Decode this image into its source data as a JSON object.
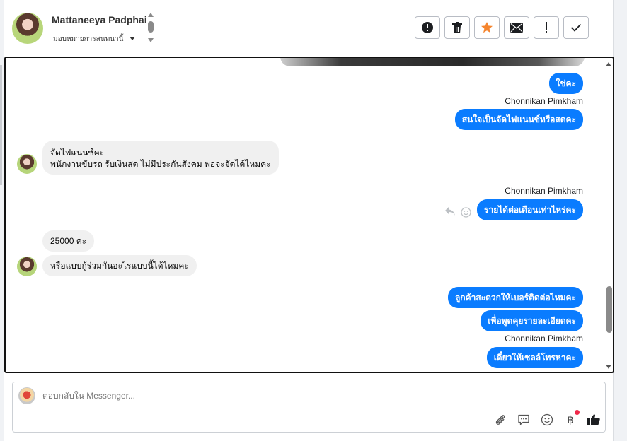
{
  "header": {
    "contact_name": "Mattaneeya Padphai",
    "assign_label": "มอบหมายการสนทนานี้",
    "actions": [
      {
        "icon": "alert-circle-icon",
        "name": "mark-spam-button"
      },
      {
        "icon": "trash-icon",
        "name": "delete-button"
      },
      {
        "icon": "star-icon",
        "name": "star-button"
      },
      {
        "icon": "envelope-icon",
        "name": "mark-unread-button"
      },
      {
        "icon": "exclamation-icon",
        "name": "follow-up-button"
      },
      {
        "icon": "check-icon",
        "name": "mark-done-button"
      }
    ]
  },
  "colors": {
    "accent": "#0a7cff",
    "incoming_bubble": "#f0f0f0",
    "star": "#f5852e"
  },
  "messages": {
    "out_1": "ใช่คะ",
    "sender_1": "Chonnikan Pimkham",
    "out_2": "สนใจเป็นจัดไฟแนนซ์หรือสดคะ",
    "in_1_line1": "จัดไฟแนนซ์คะ",
    "in_1_line2": "พนักงานขับรถ รับเงินสด ไม่มีประกันสังคม พอจะจัดได้ไหมคะ",
    "sender_2": "Chonnikan Pimkham",
    "out_3": "รายได้ต่อเดือนเท่าไหร่คะ",
    "in_2": "25000 คะ",
    "in_3": "หรือแบบกู้ร่วมกันอะไรแบบนี้ได้ไหมคะ",
    "out_4": "ลูกค้าสะดวกให้เบอร์ติดต่อไหมคะ",
    "out_5": "เพื่อพูดคุยรายละเอียดคะ",
    "sender_3": "Chonnikan Pimkham",
    "out_6": "เดี๋ยวให้เซลล์โทรหาคะ"
  },
  "composer": {
    "placeholder": "ตอบกลับใน Messenger...",
    "value": "",
    "tools": [
      "paperclip-icon",
      "saved-reply-icon",
      "emoji-icon",
      "baht-icon",
      "thumbs-up-icon"
    ],
    "baht_symbol": "฿"
  }
}
